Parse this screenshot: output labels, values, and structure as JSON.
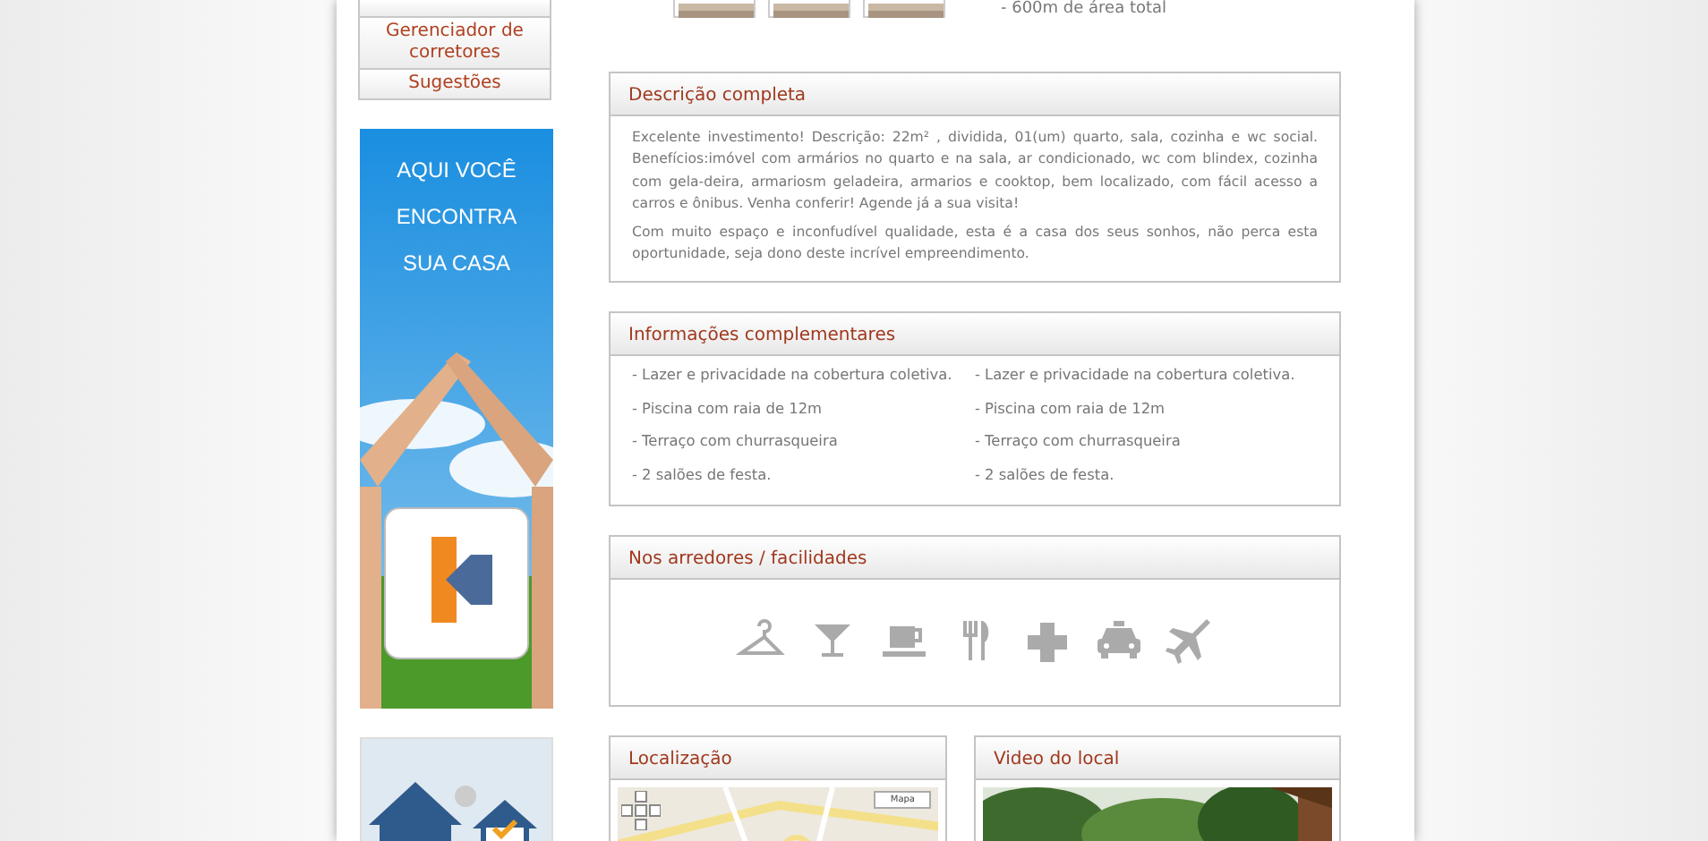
{
  "sidebar": {
    "menu": [
      {
        "label": "Gerenciador de corretores"
      },
      {
        "label": "Sugestões"
      }
    ],
    "banners": [
      {
        "kind": "picture",
        "lines": [
          "AQUI VOCÊ",
          "ENCONTRA",
          "SUA CASA"
        ]
      },
      {
        "kind": "picture"
      }
    ]
  },
  "gallery": {
    "thumbnails": [
      {
        "kind": "picture"
      },
      {
        "kind": "picture"
      },
      {
        "kind": "picture"
      }
    ]
  },
  "features_top": [
    "- 600m de área total"
  ],
  "description": {
    "title": "Descrição completa",
    "paragraphs": [
      "Excelente investimento! Descrição: 22m² , dividida, 01(um) quarto, sala, cozinha e wc social. Benefícios:imóvel com armários no quarto e na sala, ar condicionado, wc com blindex, cozinha com gela-deira, armariosm geladeira, armarios e cooktop, bem localizado, com fácil acesso a carros e ônibus. Venha conferir! Agende já a sua visita!",
      "Com muito espaço e inconfudível qualidade, esta é a casa dos seus sonhos, não perca esta oportunidade, seja dono deste incrível empreendimento."
    ]
  },
  "info": {
    "title": "Informações complementares",
    "columns": [
      [
        "- Lazer e privacidade na cobertura coletiva.",
        "- Piscina com raia de 12m",
        "- Terraço com churrasqueira",
        "- 2 salões de festa."
      ],
      [
        "- Lazer e privacidade na cobertura coletiva.",
        "- Piscina com raia de 12m",
        "- Terraço com churrasqueira",
        "- 2 salões de festa."
      ]
    ]
  },
  "surroundings": {
    "title": "Nos arredores / facilidades",
    "icons": [
      {
        "kind": "hanger"
      },
      {
        "kind": "bar"
      },
      {
        "kind": "cafe"
      },
      {
        "kind": "restaurant"
      },
      {
        "kind": "hospital"
      },
      {
        "kind": "taxi"
      },
      {
        "kind": "airport"
      }
    ]
  },
  "location": {
    "title": "Localização",
    "map_button": "Mapa"
  },
  "video": {
    "title": "Video do local"
  }
}
